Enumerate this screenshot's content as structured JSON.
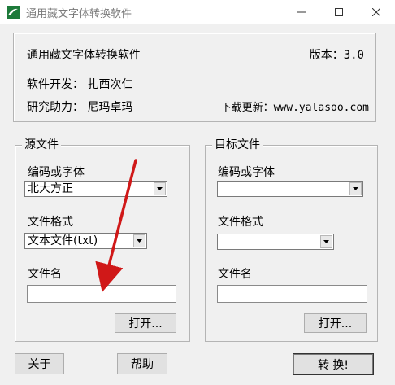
{
  "window": {
    "title": "通用藏文字体转换软件"
  },
  "info": {
    "app_name": "通用藏文字体转换软件",
    "version": "版本：3.0",
    "developer": "软件开发： 扎西次仁",
    "assistant": "研究助力： 尼玛卓玛",
    "download": "下载更新：www.yalasoo.com"
  },
  "source": {
    "group_label": "源文件",
    "encoding_label": "编码或字体",
    "encoding_value": "北大方正",
    "format_label": "文件格式",
    "format_value": "文本文件(txt)",
    "filename_label": "文件名",
    "filename_value": "",
    "open_button": "打开..."
  },
  "target": {
    "group_label": "目标文件",
    "encoding_label": "编码或字体",
    "encoding_value": "",
    "format_label": "文件格式",
    "format_value": "",
    "filename_label": "文件名",
    "filename_value": "",
    "open_button": "打开..."
  },
  "buttons": {
    "about": "关于",
    "help": "帮助",
    "convert": "转 换!"
  },
  "colors": {
    "annotation_arrow": "#d01818"
  }
}
